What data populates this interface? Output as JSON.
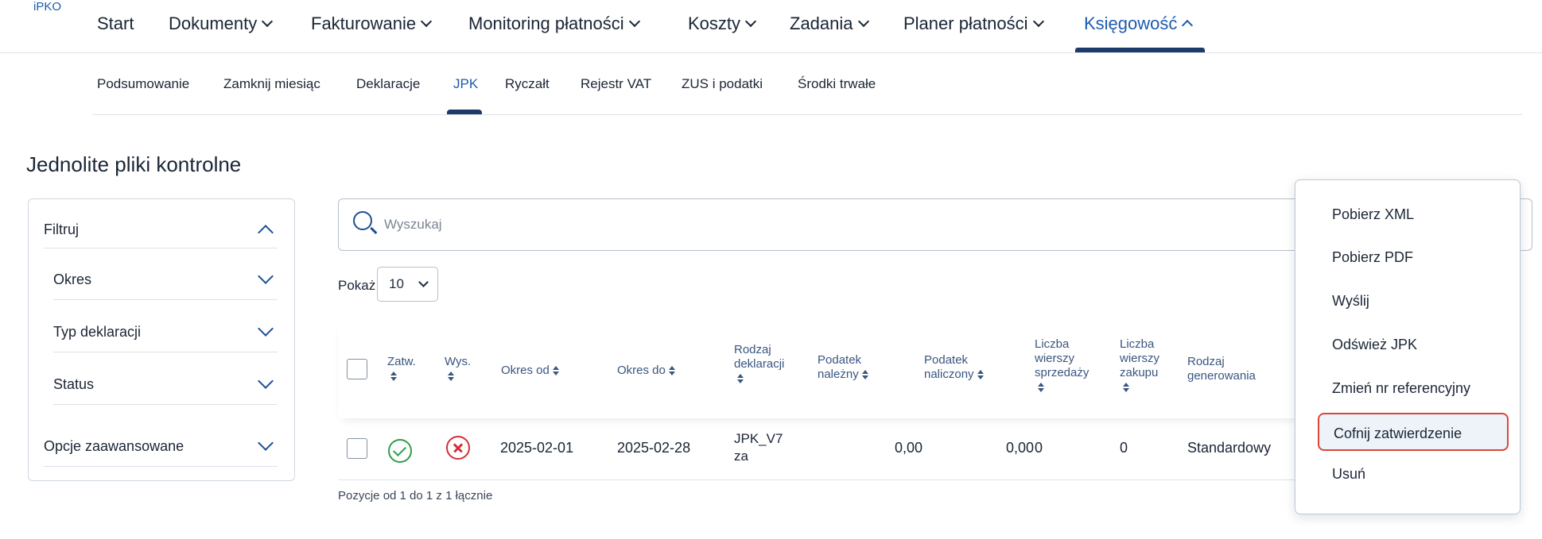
{
  "app": {
    "logo": "iPKO"
  },
  "topnav": [
    {
      "label": "Start",
      "dropdown": false,
      "active": false
    },
    {
      "label": "Dokumenty",
      "dropdown": true,
      "active": false
    },
    {
      "label": "Fakturowanie",
      "dropdown": true,
      "active": false
    },
    {
      "label": "Monitoring płatności",
      "dropdown": true,
      "active": false
    },
    {
      "label": "Koszty",
      "dropdown": true,
      "active": false
    },
    {
      "label": "Zadania",
      "dropdown": true,
      "active": false
    },
    {
      "label": "Planer płatności",
      "dropdown": true,
      "active": false
    },
    {
      "label": "Księgowość",
      "dropdown": true,
      "active": true
    }
  ],
  "subnav": [
    {
      "label": "Podsumowanie",
      "active": false
    },
    {
      "label": "Zamknij miesiąc",
      "active": false
    },
    {
      "label": "Deklaracje",
      "active": false
    },
    {
      "label": "JPK",
      "active": true
    },
    {
      "label": "Ryczałt",
      "active": false
    },
    {
      "label": "Rejestr VAT",
      "active": false
    },
    {
      "label": "ZUS i podatki",
      "active": false
    },
    {
      "label": "Środki trwałe",
      "active": false
    }
  ],
  "page": {
    "title": "Jednolite pliki kontrolne"
  },
  "filters": {
    "header": "Filtruj",
    "items": [
      "Okres",
      "Typ deklaracji",
      "Status"
    ],
    "advanced": "Opcje zaawansowane"
  },
  "search": {
    "placeholder": "Wyszukaj"
  },
  "show": {
    "label": "Pokaż",
    "value": "10"
  },
  "table": {
    "headers": {
      "approved": "Zatw.",
      "sent": "Wys.",
      "period_from": "Okres od",
      "period_to": "Okres do",
      "declaration_type": [
        "Rodzaj",
        "deklaracji"
      ],
      "tax_due": [
        "Podatek",
        "należny"
      ],
      "tax_input": [
        "Podatek",
        "naliczony"
      ],
      "sales_rows": [
        "Liczba",
        "wierszy",
        "sprzedaży"
      ],
      "purchase_rows": [
        "Liczba",
        "wierszy",
        "zakupu"
      ],
      "generation_type": [
        "Rodzaj",
        "generowania"
      ]
    },
    "rows": [
      {
        "approved": true,
        "sent": false,
        "period_from": "2025-02-01",
        "period_to": "2025-02-28",
        "declaration_type": [
          "JPK_V7",
          "za"
        ],
        "tax_due": "0,00",
        "tax_input": "0,00",
        "sales_rows": "0",
        "purchase_rows": "0",
        "generation_type": "Standardowy"
      }
    ],
    "pagination_info": "Pozycje od 1 do 1 z 1 łącznie"
  },
  "context_menu": {
    "items": [
      "Pobierz XML",
      "Pobierz PDF",
      "Wyślij",
      "Odśwież JPK",
      "Zmień nr referencyjny",
      "Cofnij zatwierdzenie",
      "Usuń"
    ],
    "highlighted_index": 5,
    "highlight_color": "#d9473b"
  },
  "colors": {
    "accent": "#1d5bb0",
    "ok": "#2f9d48",
    "error": "#d62d3a"
  }
}
